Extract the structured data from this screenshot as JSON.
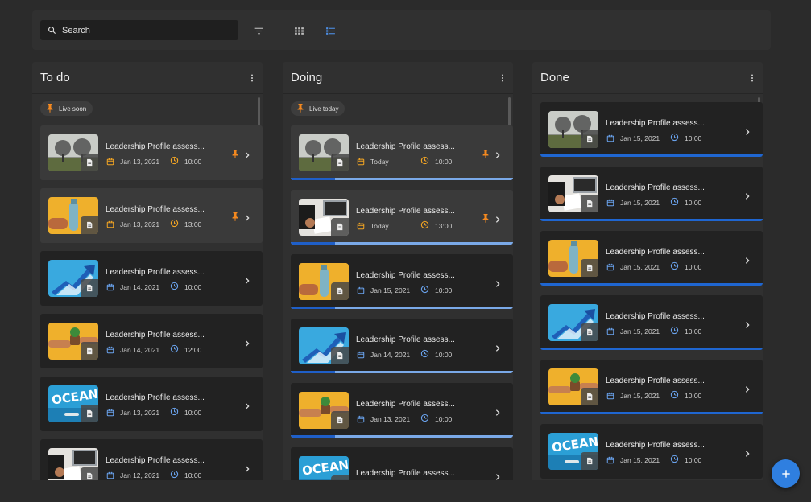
{
  "toolbar": {
    "search_placeholder": "Search",
    "icons": [
      "search-icon",
      "filter-icon",
      "grid-view-icon",
      "list-view-icon"
    ]
  },
  "colors": {
    "accent": "#2f7fe0",
    "pin": "#f5891f",
    "date_today": "#f5a623",
    "progress_track": "#7aa9e8"
  },
  "columns": [
    {
      "title": "To do",
      "chip": "Live soon",
      "cards": [
        {
          "title": "Leadership Profile assess...",
          "date": "Jan 13, 2021",
          "time": "10:00",
          "pinned": true,
          "image": "trees"
        },
        {
          "title": "Leadership Profile assess...",
          "date": "Jan 13, 2021",
          "time": "13:00",
          "pinned": true,
          "image": "bottle"
        },
        {
          "title": "Leadership Profile assess...",
          "date": "Jan 14, 2021",
          "time": "10:00",
          "pinned": false,
          "image": "arrows"
        },
        {
          "title": "Leadership Profile assess...",
          "date": "Jan 14, 2021",
          "time": "12:00",
          "pinned": false,
          "image": "plant"
        },
        {
          "title": "Leadership Profile assess...",
          "date": "Jan 13, 2021",
          "time": "10:00",
          "pinned": false,
          "image": "ocean"
        },
        {
          "title": "Leadership Profile assess...",
          "date": "Jan 12, 2021",
          "time": "10:00",
          "pinned": false,
          "image": "desk"
        }
      ]
    },
    {
      "title": "Doing",
      "chip": "Live today",
      "cards": [
        {
          "title": "Leadership Profile assess...",
          "date": "Today",
          "time": "10:00",
          "pinned": true,
          "image": "trees",
          "progress": 0.2
        },
        {
          "title": "Leadership Profile assess...",
          "date": "Today",
          "time": "13:00",
          "pinned": true,
          "image": "desk",
          "progress": 0.2
        },
        {
          "title": "Leadership Profile assess...",
          "date": "Jan 15, 2021",
          "time": "10:00",
          "pinned": false,
          "image": "bottle",
          "progress": 0.2
        },
        {
          "title": "Leadership Profile assess...",
          "date": "Jan 14, 2021",
          "time": "10:00",
          "pinned": false,
          "image": "arrows",
          "progress": 0.2
        },
        {
          "title": "Leadership Profile assess...",
          "date": "Jan 13, 2021",
          "time": "10:00",
          "pinned": false,
          "image": "plant",
          "progress": 0.2
        },
        {
          "title": "Leadership Profile assess...",
          "date": "",
          "time": "",
          "pinned": false,
          "image": "ocean",
          "progress": 0
        }
      ]
    },
    {
      "title": "Done",
      "chip": "",
      "cards": [
        {
          "title": "Leadership Profile assess...",
          "date": "Jan 15, 2021",
          "time": "10:00",
          "pinned": false,
          "image": "trees",
          "progress": 1
        },
        {
          "title": "Leadership Profile assess...",
          "date": "Jan 15, 2021",
          "time": "10:00",
          "pinned": false,
          "image": "desk",
          "progress": 1
        },
        {
          "title": "Leadership Profile assess...",
          "date": "Jan 15, 2021",
          "time": "10:00",
          "pinned": false,
          "image": "bottle",
          "progress": 1
        },
        {
          "title": "Leadership Profile assess...",
          "date": "Jan 15, 2021",
          "time": "10:00",
          "pinned": false,
          "image": "arrows",
          "progress": 1
        },
        {
          "title": "Leadership Profile assess...",
          "date": "Jan 15, 2021",
          "time": "10:00",
          "pinned": false,
          "image": "plant",
          "progress": 1
        },
        {
          "title": "Leadership Profile assess...",
          "date": "Jan 15, 2021",
          "time": "10:00",
          "pinned": false,
          "image": "ocean",
          "progress": 0
        }
      ]
    }
  ],
  "fab": {
    "icon": "plus-icon"
  }
}
